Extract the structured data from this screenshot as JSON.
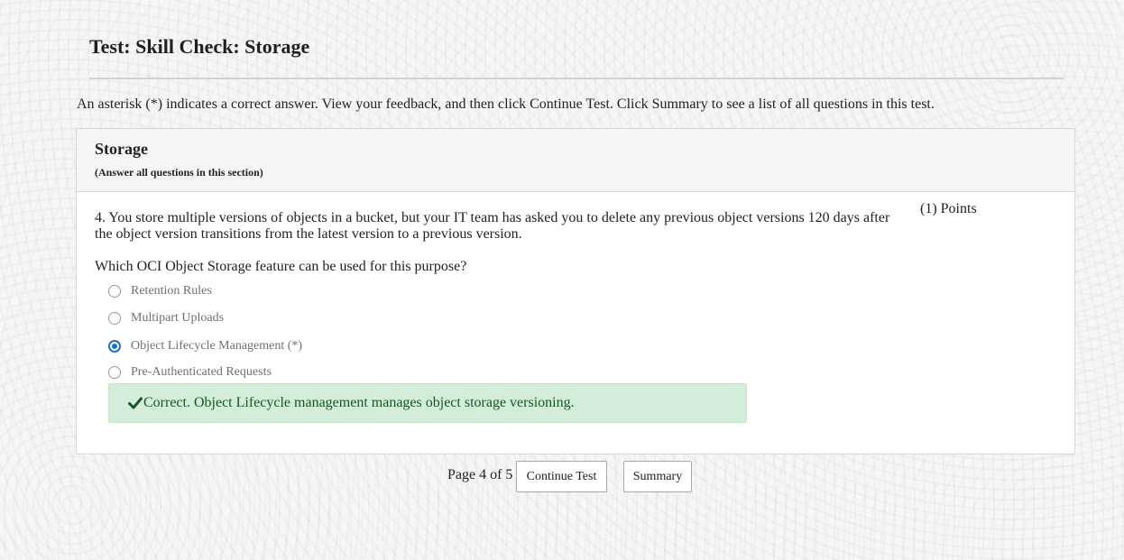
{
  "page": {
    "title": "Test: Skill Check: Storage",
    "instructions": "An asterisk (*) indicates a correct answer. View your feedback, and then click Continue Test. Click Summary to see a list of all questions in this test."
  },
  "section": {
    "title": "Storage",
    "note": "(Answer all questions in this section)"
  },
  "question": {
    "text": "4. You store multiple versions of objects in a bucket, but your IT team has asked you to delete any previous object versions 120 days after the object version transitions from the latest version to a previous version.",
    "points": "(1) Points",
    "prompt": "Which OCI Object Storage feature can be used for this purpose?",
    "options": [
      {
        "label": "Retention Rules",
        "selected": false
      },
      {
        "label": "Multipart Uploads",
        "selected": false
      },
      {
        "label": "Object Lifecycle Management (*)",
        "selected": true
      },
      {
        "label": "Pre-Authenticated Requests",
        "selected": false
      }
    ]
  },
  "feedback": {
    "text": "Correct. Object Lifecycle management manages object storage versioning.",
    "icon": "check-icon",
    "color": "#155724",
    "background": "#d4edda"
  },
  "footer": {
    "page_indicator": "Page 4 of 5",
    "continue_label": "Continue Test",
    "summary_label": "Summary"
  },
  "colors": {
    "accent": "#1a73c8"
  }
}
